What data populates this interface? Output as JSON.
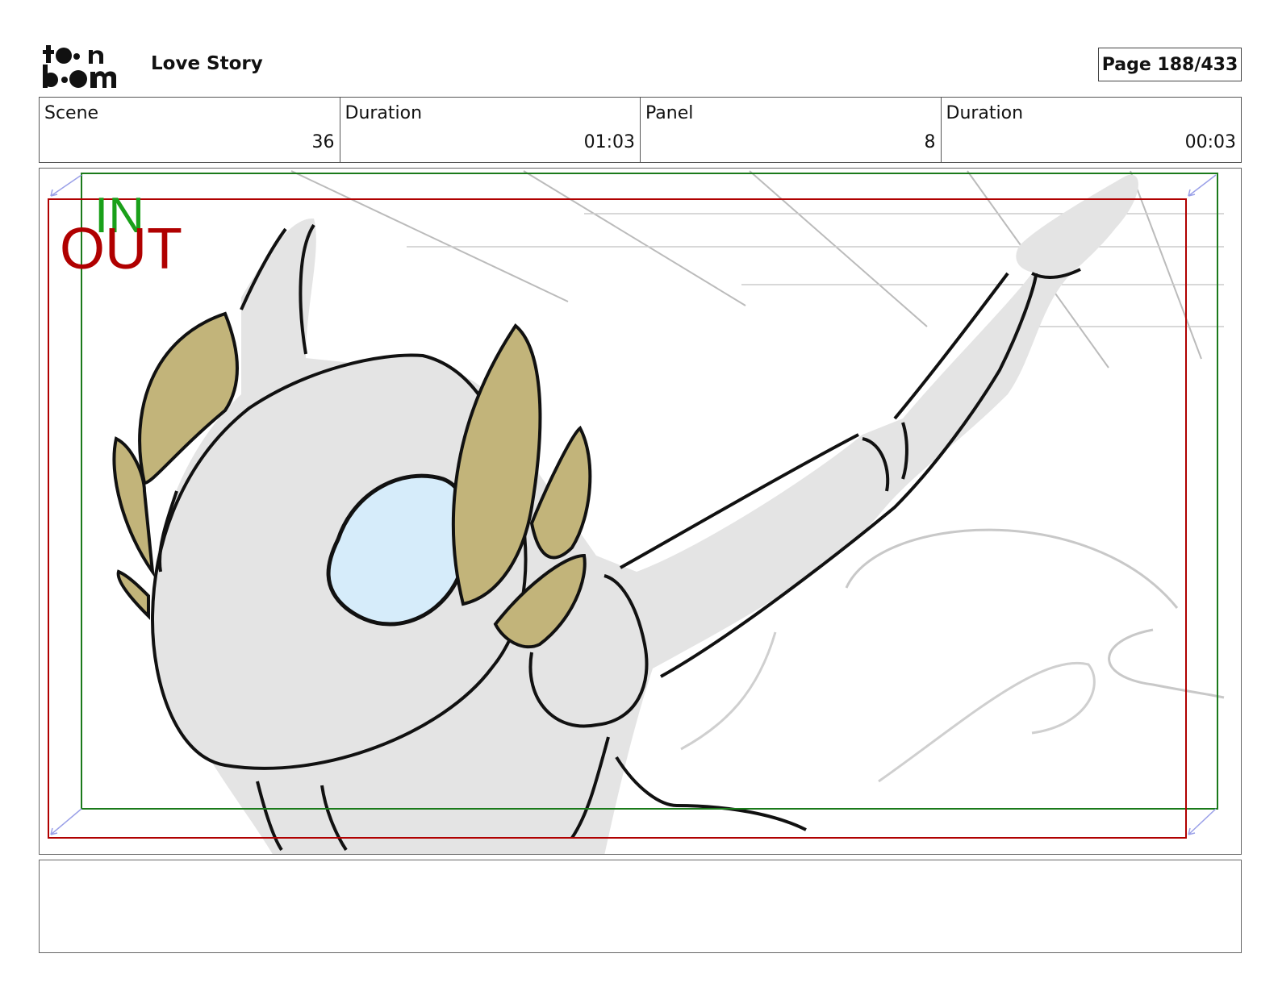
{
  "header": {
    "logo_text_top": "toon",
    "logo_text_bottom": "boom",
    "project_title": "Love Story",
    "page_label": "Page 188/433"
  },
  "info": [
    {
      "label": "Scene",
      "value": "36"
    },
    {
      "label": "Duration",
      "value": "01:03"
    },
    {
      "label": "Panel",
      "value": "8"
    },
    {
      "label": "Duration",
      "value": "00:03"
    }
  ],
  "panel": {
    "in_marker": "IN",
    "out_marker": "OUT",
    "safe_frame_color": "#1a7a1a",
    "camera_frame_color": "#b00000"
  },
  "notes": {
    "text": ""
  }
}
